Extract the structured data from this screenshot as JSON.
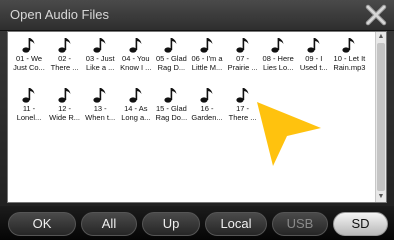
{
  "dialog": {
    "title": "Open Audio Files",
    "close_icon": "close-x-icon"
  },
  "files": [
    {
      "line1": "01 - We",
      "line2": "Just Co..."
    },
    {
      "line1": "02 -",
      "line2": "There ..."
    },
    {
      "line1": "03 - Just",
      "line2": "Like a ..."
    },
    {
      "line1": "04 - You",
      "line2": "Know I ..."
    },
    {
      "line1": "05 - Glad",
      "line2": "Rag D..."
    },
    {
      "line1": "06 - I'm a",
      "line2": "Little M..."
    },
    {
      "line1": "07 -",
      "line2": "Prairie ..."
    },
    {
      "line1": "08 - Here",
      "line2": "Lies Lo..."
    },
    {
      "line1": "09 - I",
      "line2": "Used t..."
    },
    {
      "line1": "10 - Let It",
      "line2": "Rain.mp3"
    },
    {
      "line1": "11 -",
      "line2": "Lonel..."
    },
    {
      "line1": "12 -",
      "line2": "Wide R..."
    },
    {
      "line1": "13 -",
      "line2": "When t..."
    },
    {
      "line1": "14 - As",
      "line2": "Long a..."
    },
    {
      "line1": "15 - Glad",
      "line2": "Rag Do..."
    },
    {
      "line1": "16 -",
      "line2": "Garden..."
    },
    {
      "line1": "17 -",
      "line2": "There ..."
    }
  ],
  "file_icon": "music-note-icon",
  "toolbar": {
    "ok": "OK",
    "all": "All",
    "up": "Up",
    "local": "Local",
    "usb": "USB",
    "sd": "SD"
  },
  "colors": {
    "pointer": "#ffc20e",
    "selected_button": "#dcdcdc",
    "pane_background": "#ffffff"
  }
}
